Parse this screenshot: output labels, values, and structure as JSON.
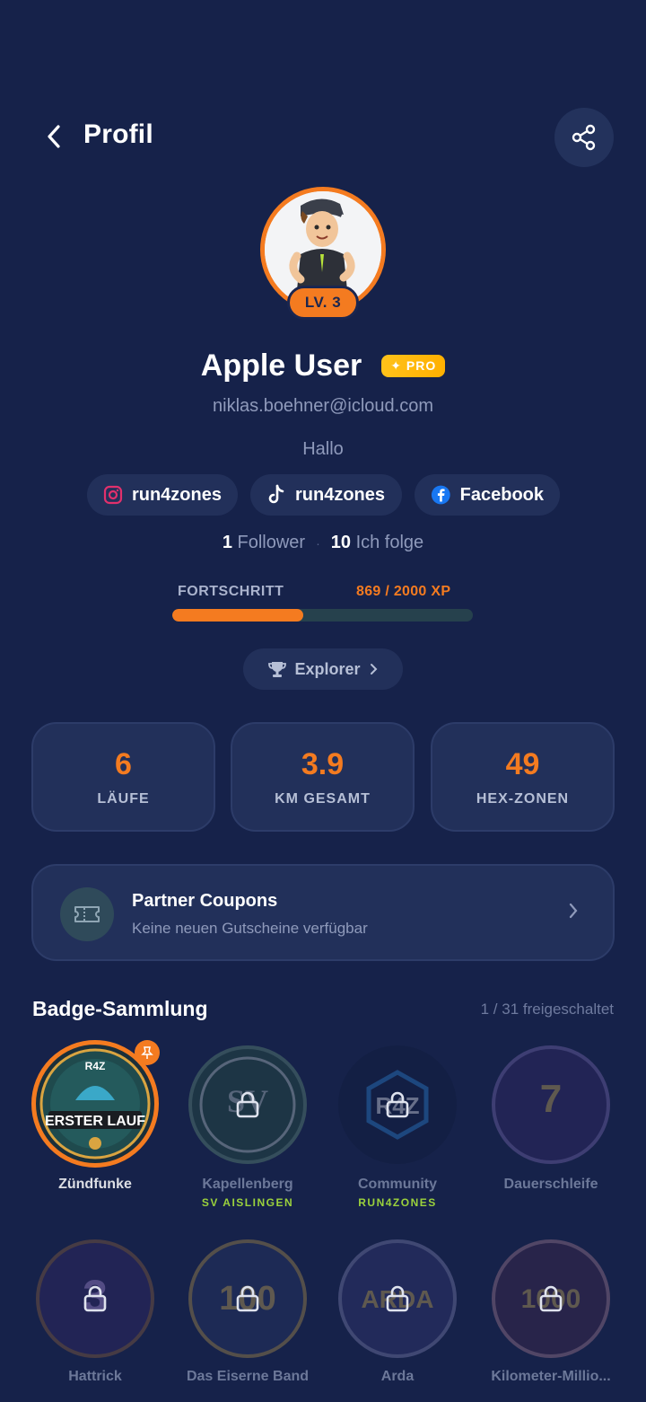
{
  "header": {
    "title": "Profil",
    "back_icon": "chevron-left-icon",
    "share_icon": "share-icon"
  },
  "profile": {
    "level": "LV. 3",
    "name": "Apple User",
    "pro_badge": "✦ PRO",
    "email": "niklas.boehner@icloud.com",
    "bio": "Hallo"
  },
  "socials": [
    {
      "platform": "instagram",
      "label": "run4zones",
      "icon": "instagram-icon"
    },
    {
      "platform": "tiktok",
      "label": "run4zones",
      "icon": "tiktok-icon"
    },
    {
      "platform": "facebook",
      "label": "Facebook",
      "icon": "facebook-icon"
    }
  ],
  "follow": {
    "followers_count": "1",
    "followers_label": "Follower",
    "following_count": "10",
    "following_label": "Ich folge",
    "separator": "·"
  },
  "progress": {
    "label": "FORTSCHRITT",
    "value_text": "869 / 2000 XP",
    "fraction": 0.4345
  },
  "rank": {
    "label": "Explorer",
    "icon": "trophy-icon"
  },
  "stats": [
    {
      "value": "6",
      "label": "LÄUFE"
    },
    {
      "value": "3.9",
      "label": "KM GESAMT"
    },
    {
      "value": "49",
      "label": "HEX-ZONEN"
    }
  ],
  "coupons": {
    "title": "Partner Coupons",
    "subtitle": "Keine neuen Gutscheine verfügbar",
    "icon": "ticket-icon"
  },
  "badges": {
    "title": "Badge-Sammlung",
    "count": "1 / 31 freigeschaltet",
    "items": [
      {
        "name": "Zündfunke",
        "sub": "",
        "unlocked": true,
        "pinned": true,
        "art_text": "ERSTER LAUF"
      },
      {
        "name": "Kapellenberg",
        "sub": "SV AISLINGEN",
        "unlocked": false,
        "art_text": "SV"
      },
      {
        "name": "Community",
        "sub": "RUN4ZONES",
        "unlocked": false,
        "art_text": "R4Z"
      },
      {
        "name": "Dauerschleife",
        "sub": "",
        "unlocked": false,
        "art_text": "7"
      },
      {
        "name": "Hattrick",
        "sub": "",
        "unlocked": false,
        "art_text": "3"
      },
      {
        "name": "Das Eiserne Band",
        "sub": "",
        "unlocked": false,
        "art_text": "100"
      },
      {
        "name": "Arda",
        "sub": "",
        "unlocked": false,
        "art_text": "ARDA"
      },
      {
        "name": "Kilometer-Millio...",
        "sub": "",
        "unlocked": false,
        "art_text": "1000"
      }
    ]
  },
  "colors": {
    "background": "#16224a",
    "card": "#22305a",
    "accent": "#f47b20",
    "pro": "#ffc21a",
    "muted": "#8f9abb",
    "green_sub": "#9bd23c"
  }
}
